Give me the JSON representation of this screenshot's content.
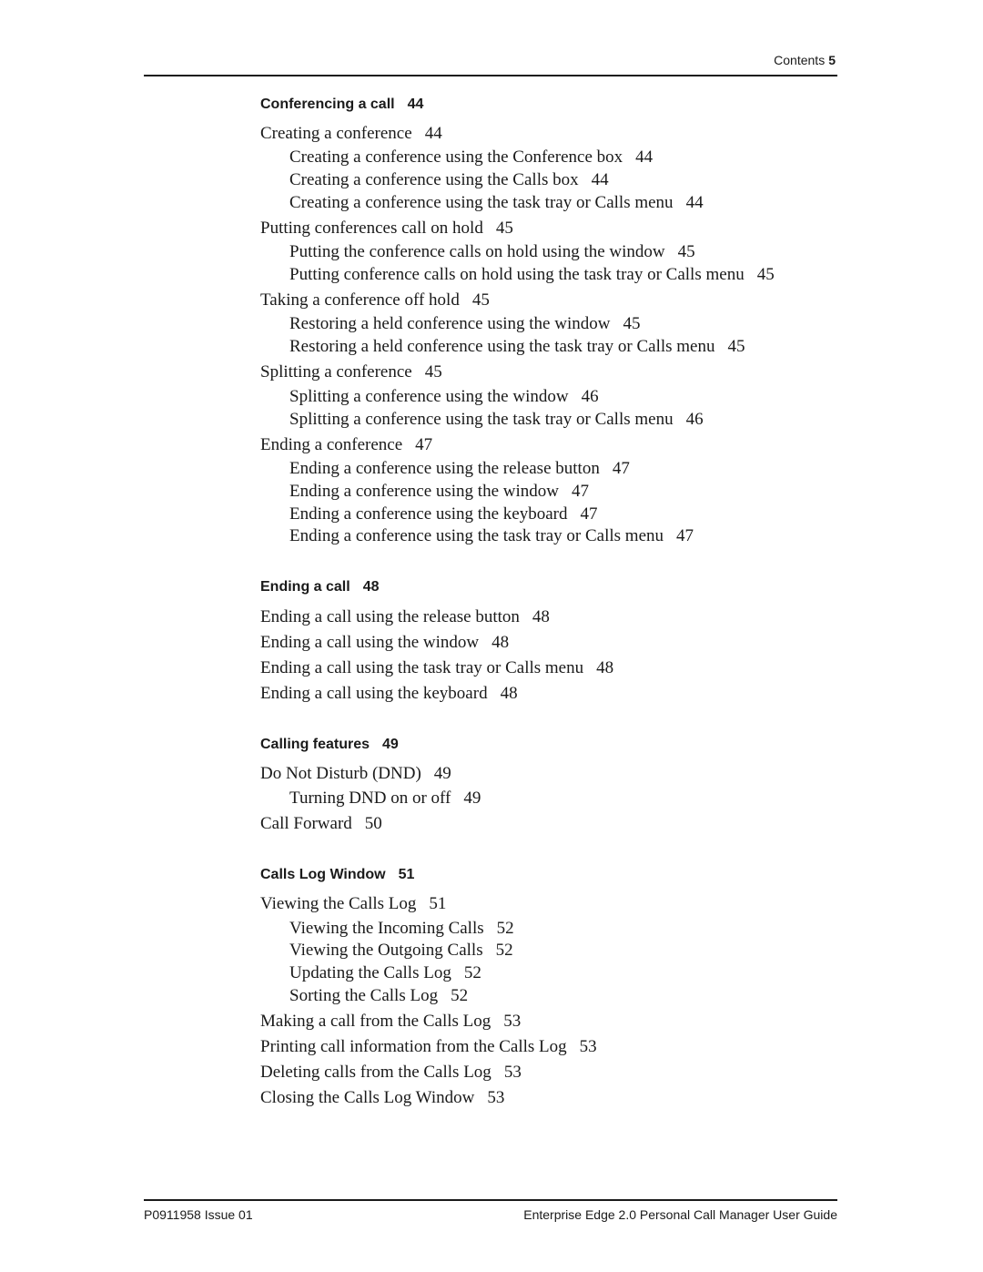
{
  "header": {
    "label": "Contents",
    "page": "5"
  },
  "sections": [
    {
      "title": "Conferencing a call",
      "page": "44",
      "entries": [
        {
          "level": 1,
          "text": "Creating a conference",
          "page": "44"
        },
        {
          "level": 2,
          "text": "Creating a conference using the Conference box",
          "page": "44"
        },
        {
          "level": 2,
          "text": "Creating a conference using the Calls box",
          "page": "44"
        },
        {
          "level": 2,
          "text": "Creating a conference using the task tray or Calls menu",
          "page": "44"
        },
        {
          "level": 1,
          "text": "Putting conferences call on hold",
          "page": "45"
        },
        {
          "level": 2,
          "text": "Putting the conference calls on hold using the window",
          "page": "45"
        },
        {
          "level": 2,
          "text": "Putting conference calls on hold using the task tray or Calls menu",
          "page": "45"
        },
        {
          "level": 1,
          "text": "Taking a conference off hold",
          "page": "45"
        },
        {
          "level": 2,
          "text": "Restoring a held conference using the window",
          "page": "45"
        },
        {
          "level": 2,
          "text": "Restoring a held conference using the task tray or Calls menu",
          "page": "45"
        },
        {
          "level": 1,
          "text": "Splitting a conference",
          "page": "45"
        },
        {
          "level": 2,
          "text": "Splitting a conference using the window",
          "page": "46"
        },
        {
          "level": 2,
          "text": "Splitting a conference using the task tray or Calls menu",
          "page": "46"
        },
        {
          "level": 1,
          "text": "Ending a conference",
          "page": "47"
        },
        {
          "level": 2,
          "text": "Ending a conference using the release button",
          "page": "47"
        },
        {
          "level": 2,
          "text": "Ending a conference using the window",
          "page": "47"
        },
        {
          "level": 2,
          "text": "Ending a conference using the keyboard",
          "page": "47"
        },
        {
          "level": 2,
          "text": "Ending a conference using the task tray or Calls menu",
          "page": "47"
        }
      ]
    },
    {
      "title": "Ending a call",
      "page": "48",
      "entries": [
        {
          "level": 1,
          "text": "Ending a call using the release button",
          "page": "48"
        },
        {
          "level": 1,
          "text": "Ending a call using the window",
          "page": "48"
        },
        {
          "level": 1,
          "text": "Ending a call using the task tray or Calls menu",
          "page": "48"
        },
        {
          "level": 1,
          "text": "Ending a call using the keyboard",
          "page": "48"
        }
      ]
    },
    {
      "title": "Calling features",
      "page": "49",
      "entries": [
        {
          "level": 1,
          "text": "Do Not Disturb (DND)",
          "page": "49"
        },
        {
          "level": 2,
          "text": "Turning DND on or off",
          "page": "49"
        },
        {
          "level": 1,
          "text": "Call Forward",
          "page": "50"
        }
      ]
    },
    {
      "title": "Calls Log Window",
      "page": "51",
      "entries": [
        {
          "level": 1,
          "text": "Viewing the Calls Log",
          "page": "51"
        },
        {
          "level": 2,
          "text": "Viewing the Incoming Calls",
          "page": "52"
        },
        {
          "level": 2,
          "text": "Viewing the Outgoing Calls",
          "page": "52"
        },
        {
          "level": 2,
          "text": "Updating the Calls Log",
          "page": "52"
        },
        {
          "level": 2,
          "text": "Sorting the Calls Log",
          "page": "52"
        },
        {
          "level": 1,
          "text": "Making a call from the Calls Log",
          "page": "53"
        },
        {
          "level": 1,
          "text": "Printing call information from the Calls Log",
          "page": "53"
        },
        {
          "level": 1,
          "text": "Deleting calls from the Calls Log",
          "page": "53"
        },
        {
          "level": 1,
          "text": "Closing the Calls Log Window",
          "page": "53"
        }
      ]
    }
  ],
  "footer": {
    "left": "P0911958 Issue 01",
    "right": "Enterprise Edge 2.0 Personal Call Manager User Guide"
  }
}
